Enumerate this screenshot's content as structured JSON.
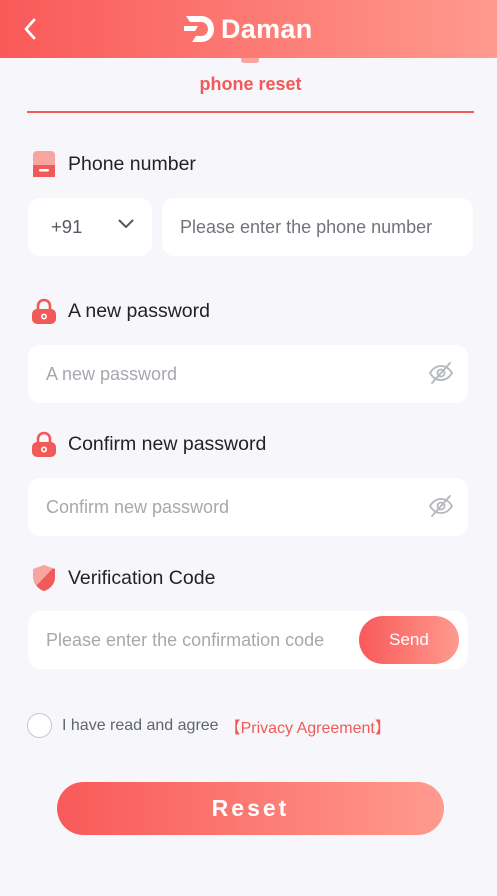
{
  "header": {
    "brand": "Daman",
    "back_icon": "chevron-left-icon",
    "logo_icon": "daman-logo-icon",
    "colors": {
      "gradient_start": "#f95959",
      "gradient_end": "#ff9a8e"
    }
  },
  "tab": {
    "label": "phone reset"
  },
  "phone": {
    "label": "Phone number",
    "icon": "phone-icon",
    "country_code": "+91",
    "placeholder": "Please enter the phone number"
  },
  "new_password": {
    "label": "A new password",
    "icon": "lock-icon",
    "placeholder": "A new password"
  },
  "confirm_password": {
    "label": "Confirm new password",
    "icon": "lock-icon",
    "placeholder": "Confirm new password"
  },
  "verification": {
    "label": "Verification Code",
    "icon": "shield-icon",
    "placeholder": "Please enter the confirmation code",
    "send_label": "Send"
  },
  "agreement": {
    "text": "I have read and agree",
    "link": "【Privacy Agreement】",
    "checked": false
  },
  "reset_button": {
    "label": "Reset"
  },
  "colors": {
    "accent": "#f05a58",
    "background": "#f6f6fb"
  }
}
